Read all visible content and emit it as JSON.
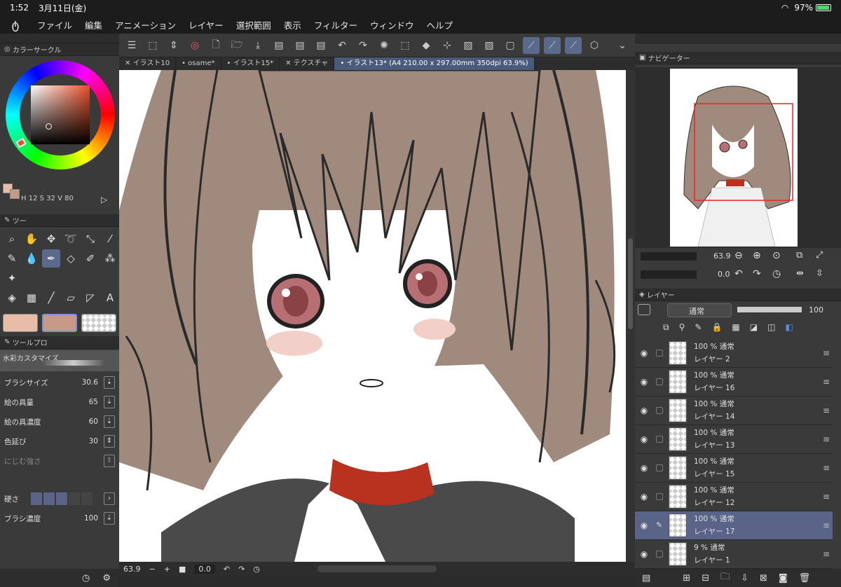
{
  "status": {
    "time": "1:52",
    "date": "3月11日(金)",
    "battery": "97%"
  },
  "menu": [
    "ファイル",
    "編集",
    "アニメーション",
    "レイヤー",
    "選択範囲",
    "表示",
    "フィルター",
    "ウィンドウ",
    "ヘルプ"
  ],
  "colorPanel": {
    "title": "カラーサークル",
    "h": "12",
    "s": "32",
    "v": "80",
    "hl": "H",
    "sl": "S",
    "vl": "V"
  },
  "toolPanel": {
    "title": "ツー"
  },
  "toolProp": {
    "title": "ツールプロ",
    "brush": "水彩カスタマイズ",
    "props": [
      {
        "label": "ブラシサイズ",
        "value": "30.6"
      },
      {
        "label": "絵の具量",
        "value": "65"
      },
      {
        "label": "絵の具濃度",
        "value": "60"
      },
      {
        "label": "色延び",
        "value": "30"
      },
      {
        "label": "にじむ強さ",
        "value": ""
      }
    ],
    "hardness": "硬さ",
    "density": {
      "label": "ブラシ濃度",
      "value": "100"
    }
  },
  "tabs": [
    "イラスト10",
    "osame*",
    "イラスト15*",
    "テクスチャ",
    "イラスト13* (A4 210.00 x 297.00mm 350dpi 63.9%)"
  ],
  "canvasBottom": {
    "zoom": "63.9",
    "rotate": "0.0"
  },
  "navigator": {
    "title": "ナビゲーター",
    "zoom": "63.9",
    "rotate": "0.0"
  },
  "layerPanel": {
    "title": "レイヤー",
    "blend": "通常",
    "opacity": "100"
  },
  "layers": [
    {
      "pct": "100 %",
      "mode": "通常",
      "name": "レイヤー 2",
      "selected": false
    },
    {
      "pct": "100 %",
      "mode": "通常",
      "name": "レイヤー 16",
      "selected": false
    },
    {
      "pct": "100 %",
      "mode": "通常",
      "name": "レイヤー 14",
      "selected": false
    },
    {
      "pct": "100 %",
      "mode": "通常",
      "name": "レイヤー 13",
      "selected": false
    },
    {
      "pct": "100 %",
      "mode": "通常",
      "name": "レイヤー 15",
      "selected": false
    },
    {
      "pct": "100 %",
      "mode": "通常",
      "name": "レイヤー 12",
      "selected": false
    },
    {
      "pct": "100 %",
      "mode": "通常",
      "name": "レイヤー 17",
      "selected": true
    },
    {
      "pct": "9 %",
      "mode": "通常",
      "name": "レイヤー 1",
      "selected": false
    }
  ],
  "colors": {
    "main": "#e8bda7",
    "sub": "#c79a88",
    "hair": "#a08a7d",
    "collar": "#b8321f",
    "bgSel": "#5a6489"
  }
}
